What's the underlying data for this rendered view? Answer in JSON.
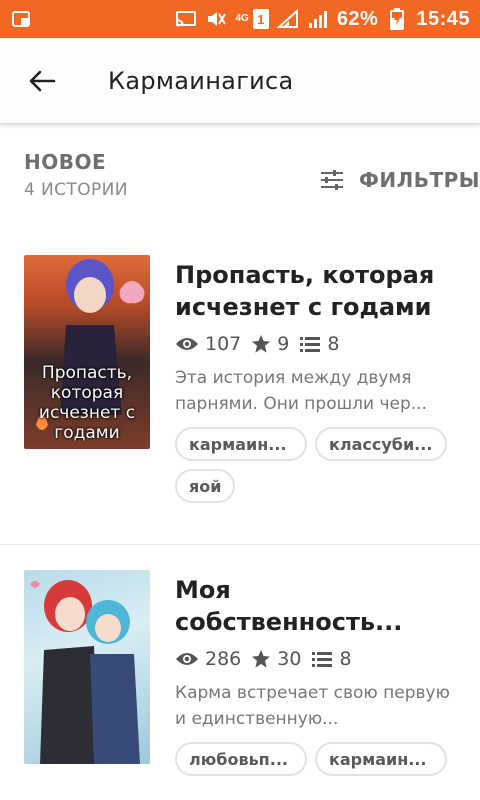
{
  "status_bar": {
    "net_type": "4G",
    "sim_slot": "1",
    "battery": "62%",
    "time": "15:45",
    "color": "#f26722"
  },
  "app_bar": {
    "title": "Кармаинагиса",
    "back_icon": "arrow-left-icon"
  },
  "section": {
    "title": "НОВОЕ",
    "count": "4 ИСТОРИИ",
    "filter_label": "ФИЛЬТРЫ",
    "filter_icon": "sliders-icon"
  },
  "stories": [
    {
      "cover_text": "Пропасть, которая исчезнет с годами",
      "title": "Пропасть, которая исчезнет с годами",
      "reads": "107",
      "votes": "9",
      "parts": "8",
      "description": "Эта история между двумя парнями. Они прошли чер...",
      "tags": [
        "кармаин...",
        "классуби...",
        "яой"
      ]
    },
    {
      "cover_text": "",
      "title": "Моя собственность...",
      "reads": "286",
      "votes": "30",
      "parts": "8",
      "description": "Карма встречает свою первую и единственную...",
      "tags": [
        "любовьп...",
        "кармаин..."
      ]
    }
  ]
}
